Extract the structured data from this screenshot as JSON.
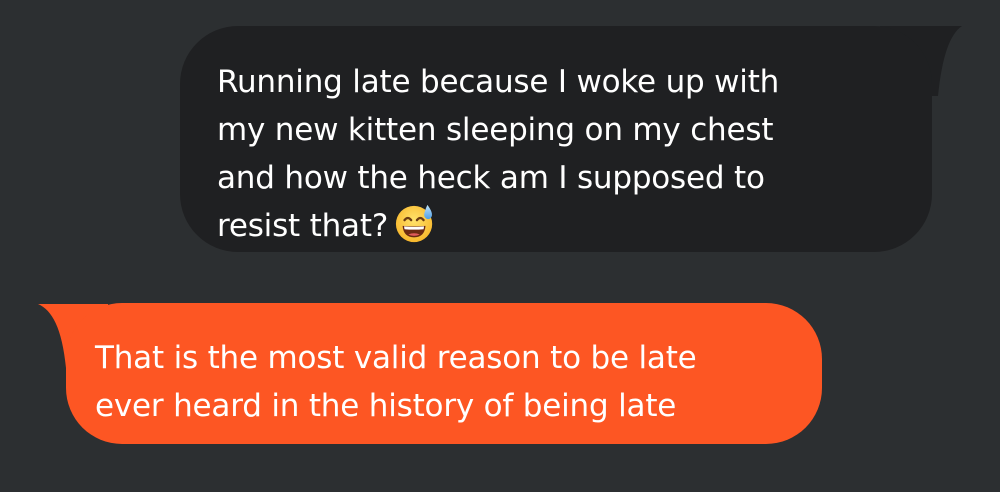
{
  "conversation": {
    "messages": [
      {
        "direction": "sent",
        "text": "Running late because I woke up with\nmy new kitten sleeping on my chest\nand how the heck am I supposed to\nresist that?",
        "emoji": "grinning-face-with-sweat-icon",
        "bubble_color": "#1f2022"
      },
      {
        "direction": "received",
        "text": "That is the most valid reason to be late\never heard in the history of being late",
        "bubble_color": "#fd5623"
      }
    ],
    "background_color": "#2c2f31"
  }
}
